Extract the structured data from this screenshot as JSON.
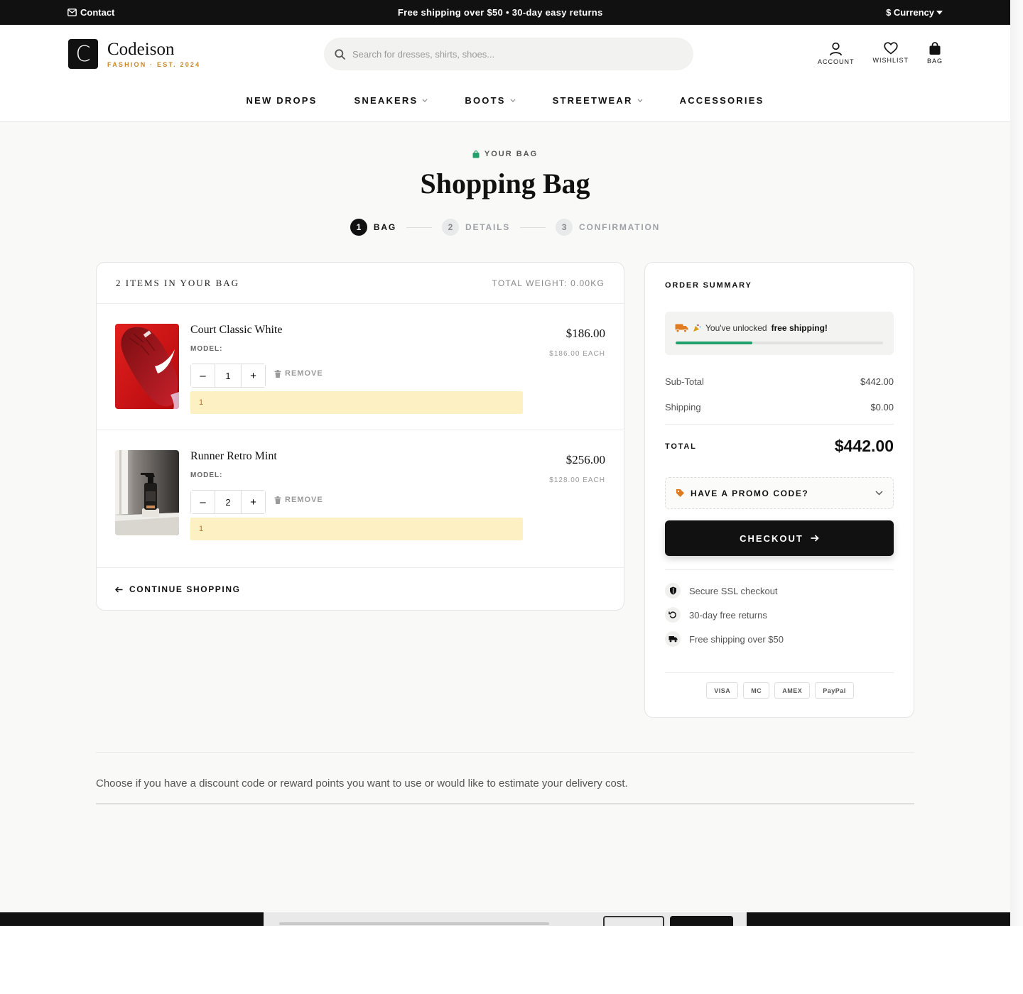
{
  "topbar": {
    "contact": "Contact",
    "promo": "Free shipping over $50 • 30-day easy returns",
    "currency": "$ Currency"
  },
  "brand": {
    "letter": "C",
    "name": "Codeison",
    "tagline": "FASHION · EST. 2024"
  },
  "search": {
    "placeholder": "Search for dresses, shirts, shoes..."
  },
  "header_actions": [
    {
      "label": "ACCOUNT",
      "icon": "user-icon"
    },
    {
      "label": "WISHLIST",
      "icon": "heart-icon"
    },
    {
      "label": "BAG",
      "icon": "bag-icon"
    }
  ],
  "nav": [
    {
      "label": "NEW DROPS",
      "dropdown": false
    },
    {
      "label": "SNEAKERS",
      "dropdown": true
    },
    {
      "label": "BOOTS",
      "dropdown": true
    },
    {
      "label": "STREETWEAR",
      "dropdown": true
    },
    {
      "label": "ACCESSORIES",
      "dropdown": false
    }
  ],
  "hero": {
    "eyebrow": "YOUR BAG",
    "title": "Shopping Bag"
  },
  "steps": [
    {
      "num": "1",
      "label": "BAG",
      "active": true
    },
    {
      "num": "2",
      "label": "DETAILS",
      "active": false
    },
    {
      "num": "3",
      "label": "CONFIRMATION",
      "active": false
    }
  ],
  "cart": {
    "count_label": "2 ITEMS IN YOUR BAG",
    "weight_label": "TOTAL WEIGHT: 0.00KG",
    "items": [
      {
        "name": "Court Classic White",
        "model_label": "MODEL:",
        "quantity": "1",
        "remove_label": "REMOVE",
        "note": "1",
        "price": "$186.00",
        "each": "$186.00 EACH"
      },
      {
        "name": "Runner Retro Mint",
        "model_label": "MODEL:",
        "quantity": "2",
        "remove_label": "REMOVE",
        "note": "1",
        "price": "$256.00",
        "each": "$128.00 EACH"
      }
    ],
    "continue_label": "CONTINUE SHOPPING"
  },
  "summary": {
    "title": "ORDER SUMMARY",
    "free_shipping_prefix": "You've unlocked",
    "free_shipping_bold": "free shipping!",
    "free_shipping_progress_percent": 37,
    "subtotal_label": "Sub-Total",
    "subtotal_value": "$442.00",
    "shipping_label": "Shipping",
    "shipping_value": "$0.00",
    "total_label": "TOTAL",
    "total_value": "$442.00",
    "promo_label": "HAVE A PROMO CODE?",
    "checkout_label": "CHECKOUT",
    "trust": [
      {
        "label": "Secure SSL checkout",
        "icon": "shield-icon"
      },
      {
        "label": "30-day free returns",
        "icon": "return-icon"
      },
      {
        "label": "Free shipping over $50",
        "icon": "truck-icon"
      }
    ],
    "payments": [
      "VISA",
      "MC",
      "AMEX",
      "PayPal"
    ]
  },
  "bottom": {
    "text": "Choose if you have a discount code or reward points you want to use or would like to estimate your delivery cost."
  },
  "colors": {
    "accent_gold": "#c8872b",
    "success_green": "#22a06b",
    "dark": "#111111",
    "note_bg": "#fdf1c4"
  }
}
